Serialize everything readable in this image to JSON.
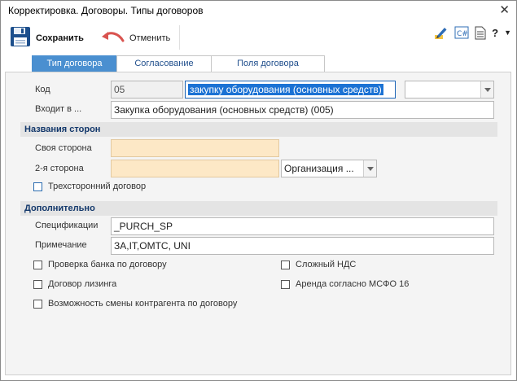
{
  "window": {
    "title": "Корректировка. Договоры. Типы договоров"
  },
  "toolbar": {
    "save_label": "Сохранить",
    "undo_label": "Отменить",
    "right_icons": [
      "edit-pencil-icon",
      "csharp-icon",
      "document-icon",
      "help-icon",
      "dropdown-arrow-icon"
    ],
    "help_text": "?"
  },
  "tabs": [
    {
      "label": "Тип договора",
      "active": true
    },
    {
      "label": "Согласование",
      "active": false
    },
    {
      "label": "Поля договора",
      "active": false
    }
  ],
  "form": {
    "code_label": "Код",
    "code_value": "05",
    "name_selected": "закупку оборудования (основных средств)",
    "extra_combo_value": "",
    "parent_label": "Входит в ...",
    "parent_value": "Закупка оборудования (основных средств) (005)"
  },
  "parties": {
    "header": "Названия сторон",
    "own_label": "Своя сторона",
    "own_value": "",
    "second_label": "2-я сторона",
    "second_value": "",
    "second_type_value": "Организация ...",
    "trilateral_label": "Трехсторонний договор",
    "trilateral_checked": false
  },
  "additional": {
    "header": "Дополнительно",
    "spec_label": "Спецификации",
    "spec_value": "_PURCH_SP",
    "note_label": "Примечание",
    "note_value": "ЗА,IT,ОМТС, UNI",
    "checkboxes": [
      {
        "label": "Проверка банка по договору",
        "checked": false
      },
      {
        "label": "Сложный НДС",
        "checked": false
      },
      {
        "label": "Договор лизинга",
        "checked": false
      },
      {
        "label": "Аренда согласно МСФО 16",
        "checked": false
      },
      {
        "label": "Возможность смены контрагента по договору",
        "checked": false
      }
    ]
  },
  "colors": {
    "accent": "#4a8fd0",
    "selection": "#1b72d4",
    "required_field": "#fde8c6",
    "section_header_text": "#13386b"
  }
}
